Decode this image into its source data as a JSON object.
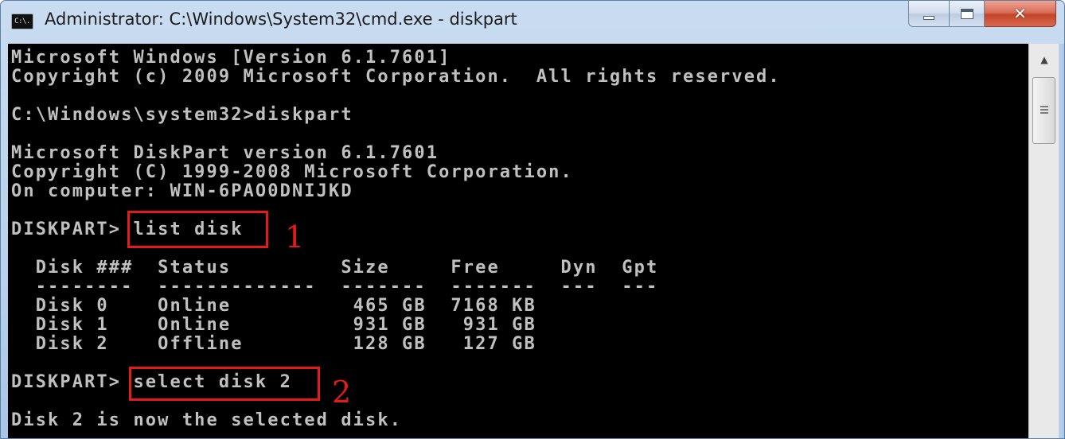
{
  "window": {
    "title": "Administrator: C:\\Windows\\System32\\cmd.exe - diskpart",
    "icon_text": "C:\\.",
    "icon": "cmd-console-icon",
    "buttons": {
      "minimize_icon": "minimize-icon",
      "maximize_icon": "maximize-icon",
      "close_icon": "close-icon",
      "close_glyph": "✕"
    }
  },
  "console": {
    "lines": [
      "Microsoft Windows [Version 6.1.7601]",
      "Copyright (c) 2009 Microsoft Corporation.  All rights reserved.",
      "",
      "C:\\Windows\\system32>diskpart",
      "",
      "Microsoft DiskPart version 6.1.7601",
      "Copyright (C) 1999-2008 Microsoft Corporation.",
      "On computer: WIN-6PAO0DNIJKD",
      "",
      "DISKPART> list disk",
      "",
      "  Disk ###  Status         Size     Free     Dyn  Gpt",
      "  --------  -------------  -------  -------  ---  ---",
      "  Disk 0    Online          465 GB  7168 KB",
      "  Disk 1    Online          931 GB   931 GB",
      "  Disk 2    Offline         128 GB   127 GB",
      "",
      "DISKPART> select disk 2",
      "",
      "Disk 2 is now the selected disk."
    ],
    "annotations": [
      {
        "label": "1",
        "command": "list disk"
      },
      {
        "label": "2",
        "command": "select disk 2"
      }
    ],
    "colors": {
      "background": "#000000",
      "text": "#c0c0c0",
      "annotation": "#e41b1b"
    }
  },
  "scrollbar": {
    "up_arrow": "▲",
    "up_icon": "scroll-up-arrow-icon",
    "thumb_icon": "scroll-grip-icon"
  }
}
